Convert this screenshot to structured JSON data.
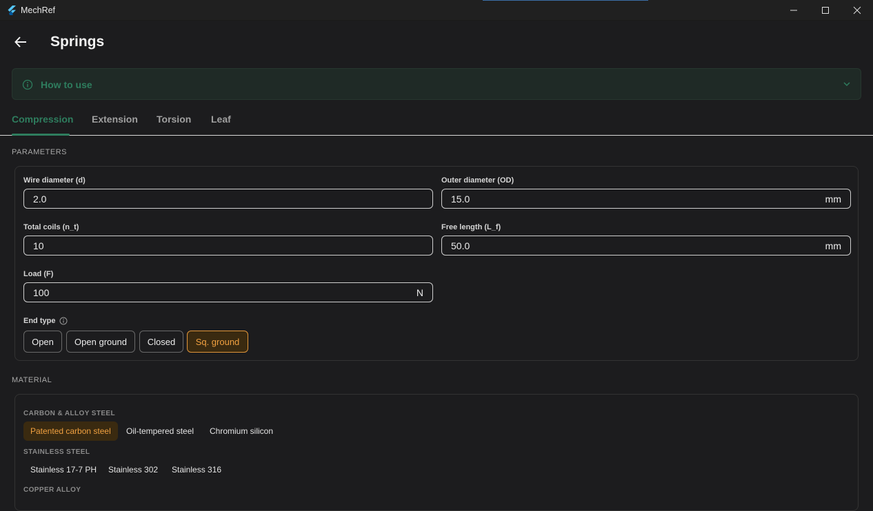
{
  "window": {
    "app_name": "MechRef",
    "minimize_icon": "minimize-icon",
    "maximize_icon": "maximize-icon",
    "close_icon": "close-icon"
  },
  "header": {
    "title": "Springs",
    "back_icon": "arrow-left-icon"
  },
  "howto": {
    "label": "How to use",
    "icon": "info-icon",
    "chevron": "chevron-down-icon"
  },
  "tabs": [
    {
      "label": "Compression",
      "active": true
    },
    {
      "label": "Extension",
      "active": false
    },
    {
      "label": "Torsion",
      "active": false
    },
    {
      "label": "Leaf",
      "active": false
    }
  ],
  "parameters": {
    "section_title": "PARAMETERS",
    "wire_diameter": {
      "label": "Wire diameter (d)",
      "value": "2.0",
      "unit": ""
    },
    "outer_diameter": {
      "label": "Outer diameter (OD)",
      "value": "15.0",
      "unit": "mm"
    },
    "total_coils": {
      "label": "Total coils (n_t)",
      "value": "10",
      "unit": ""
    },
    "free_length": {
      "label": "Free length (L_f)",
      "value": "50.0",
      "unit": "mm"
    },
    "load": {
      "label": "Load (F)",
      "value": "100",
      "unit": "N"
    },
    "end_type": {
      "label": "End type",
      "options": [
        {
          "label": "Open",
          "selected": false
        },
        {
          "label": "Open ground",
          "selected": false
        },
        {
          "label": "Closed",
          "selected": false
        },
        {
          "label": "Sq. ground",
          "selected": true
        }
      ]
    }
  },
  "material": {
    "section_title": "MATERIAL",
    "groups": [
      {
        "title": "CARBON & ALLOY STEEL",
        "items": [
          {
            "label": "Patented carbon steel",
            "selected": true
          },
          {
            "label": "Oil-tempered steel",
            "selected": false
          },
          {
            "label": "Chromium silicon",
            "selected": false
          }
        ]
      },
      {
        "title": "STAINLESS STEEL",
        "items": [
          {
            "label": "Stainless 17-7 PH",
            "selected": false
          },
          {
            "label": "Stainless 302",
            "selected": false
          },
          {
            "label": "Stainless 316",
            "selected": false
          }
        ]
      },
      {
        "title": "COPPER ALLOY",
        "items": []
      }
    ]
  },
  "colors": {
    "accent_green": "#2e7d5e",
    "accent_orange": "#f0a040",
    "background": "#1c1c1e"
  }
}
